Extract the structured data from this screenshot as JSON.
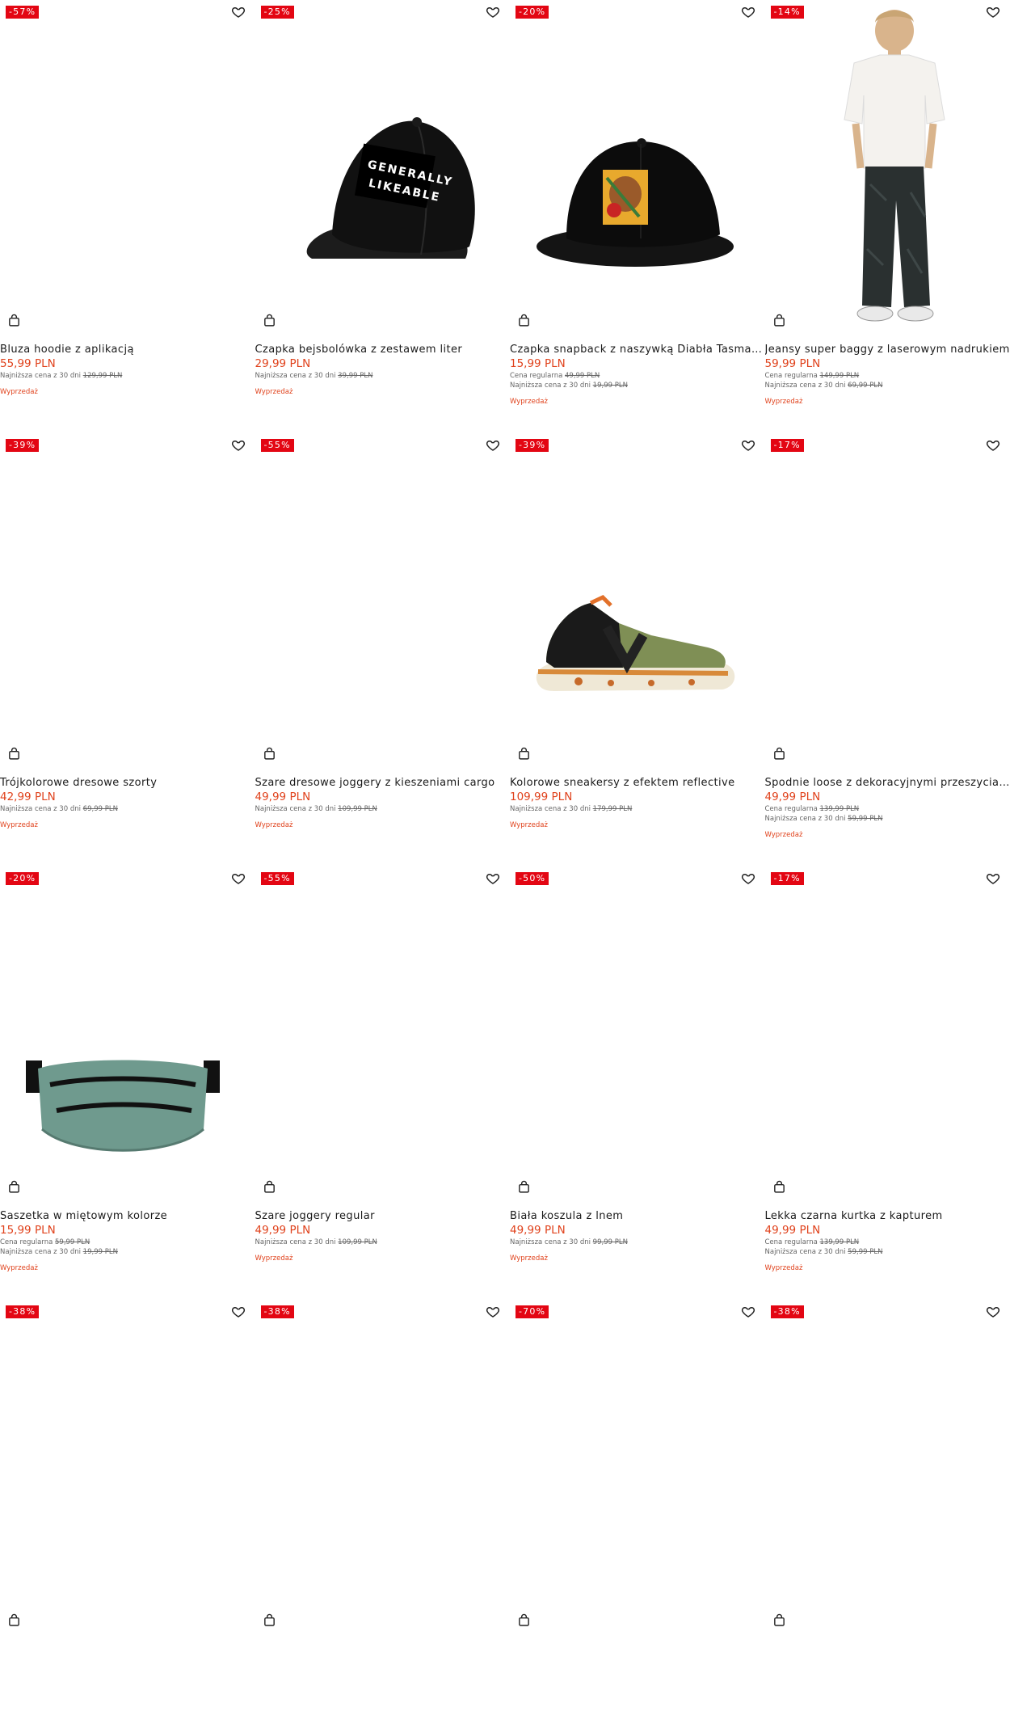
{
  "products": [
    {
      "discount": "-57%",
      "name": "Bluza hoodie z aplikacją",
      "price": "55,99 PLN",
      "regular_label": "",
      "regular_price": "",
      "lowest_label": "Najniższa cena z 30 dni",
      "lowest_price": "129,99 PLN",
      "sale_label": "Wyprzedaż",
      "image": "none"
    },
    {
      "discount": "-25%",
      "name": "Czapka bejsbolówka z zestawem liter",
      "price": "29,99 PLN",
      "regular_label": "",
      "regular_price": "",
      "lowest_label": "Najniższa cena z 30 dni",
      "lowest_price": "39,99 PLN",
      "sale_label": "Wyprzedaż",
      "image": "baseball-cap",
      "image_text": [
        "GENERALLY",
        "LIKEABLE"
      ]
    },
    {
      "discount": "-20%",
      "name": "Czapka snapback z naszywką Diabła Tasmańsk...",
      "price": "15,99 PLN",
      "regular_label": "Cena regularna",
      "regular_price": "49,99 PLN",
      "lowest_label": "Najniższa cena z 30 dni",
      "lowest_price": "19,99 PLN",
      "sale_label": "Wyprzedaż",
      "image": "snapback-cap"
    },
    {
      "discount": "-14%",
      "name": "Jeansy super baggy z laserowym nadrukiem",
      "price": "59,99 PLN",
      "regular_label": "Cena regularna",
      "regular_price": "149,99 PLN",
      "lowest_label": "Najniższa cena z 30 dni",
      "lowest_price": "69,99 PLN",
      "sale_label": "Wyprzedaż",
      "image": "model-baggy-jeans"
    },
    {
      "discount": "-39%",
      "name": "Trójkolorowe dresowe szorty",
      "price": "42,99 PLN",
      "regular_label": "",
      "regular_price": "",
      "lowest_label": "Najniższa cena z 30 dni",
      "lowest_price": "69,99 PLN",
      "sale_label": "Wyprzedaż",
      "image": "none"
    },
    {
      "discount": "-55%",
      "name": "Szare dresowe joggery z kieszeniami cargo",
      "price": "49,99 PLN",
      "regular_label": "",
      "regular_price": "",
      "lowest_label": "Najniższa cena z 30 dni",
      "lowest_price": "109,99 PLN",
      "sale_label": "Wyprzedaż",
      "image": "none"
    },
    {
      "discount": "-39%",
      "name": "Kolorowe sneakersy z efektem reflective",
      "price": "109,99 PLN",
      "regular_label": "",
      "regular_price": "",
      "lowest_label": "Najniższa cena z 30 dni",
      "lowest_price": "179,99 PLN",
      "sale_label": "Wyprzedaż",
      "image": "sneaker"
    },
    {
      "discount": "-17%",
      "name": "Spodnie loose z dekoracyjnymi przeszyciami",
      "price": "49,99 PLN",
      "regular_label": "Cena regularna",
      "regular_price": "139,99 PLN",
      "lowest_label": "Najniższa cena z 30 dni",
      "lowest_price": "59,99 PLN",
      "sale_label": "Wyprzedaż",
      "image": "none"
    },
    {
      "discount": "-20%",
      "name": "Saszetka w miętowym kolorze",
      "price": "15,99 PLN",
      "regular_label": "Cena regularna",
      "regular_price": "59,99 PLN",
      "lowest_label": "Najniższa cena z 30 dni",
      "lowest_price": "19,99 PLN",
      "sale_label": "Wyprzedaż",
      "image": "waist-bag"
    },
    {
      "discount": "-55%",
      "name": "Szare joggery regular",
      "price": "49,99 PLN",
      "regular_label": "",
      "regular_price": "",
      "lowest_label": "Najniższa cena z 30 dni",
      "lowest_price": "109,99 PLN",
      "sale_label": "Wyprzedaż",
      "image": "none"
    },
    {
      "discount": "-50%",
      "name": "Biała koszula z lnem",
      "price": "49,99 PLN",
      "regular_label": "",
      "regular_price": "",
      "lowest_label": "Najniższa cena z 30 dni",
      "lowest_price": "99,99 PLN",
      "sale_label": "Wyprzedaż",
      "image": "none"
    },
    {
      "discount": "-17%",
      "name": "Lekka czarna kurtka z kapturem",
      "price": "49,99 PLN",
      "regular_label": "Cena regularna",
      "regular_price": "139,99 PLN",
      "lowest_label": "Najniższa cena z 30 dni",
      "lowest_price": "59,99 PLN",
      "sale_label": "Wyprzedaż",
      "image": "none"
    },
    {
      "discount": "-38%",
      "name": "",
      "price": "",
      "regular_label": "",
      "regular_price": "",
      "lowest_label": "",
      "lowest_price": "",
      "sale_label": "",
      "image": "none"
    },
    {
      "discount": "-38%",
      "name": "",
      "price": "",
      "regular_label": "",
      "regular_price": "",
      "lowest_label": "",
      "lowest_price": "",
      "sale_label": "",
      "image": "none"
    },
    {
      "discount": "-70%",
      "name": "",
      "price": "",
      "regular_label": "",
      "regular_price": "",
      "lowest_label": "",
      "lowest_price": "",
      "sale_label": "",
      "image": "none"
    },
    {
      "discount": "-38%",
      "name": "",
      "price": "",
      "regular_label": "",
      "regular_price": "",
      "lowest_label": "",
      "lowest_price": "",
      "sale_label": "",
      "image": "none"
    }
  ],
  "icons": {
    "favorite": "heart-icon",
    "cart": "shopping-bag-icon"
  },
  "colors": {
    "discount_badge": "#e30613",
    "price": "#e0421c",
    "sale_label": "#e0421c"
  }
}
